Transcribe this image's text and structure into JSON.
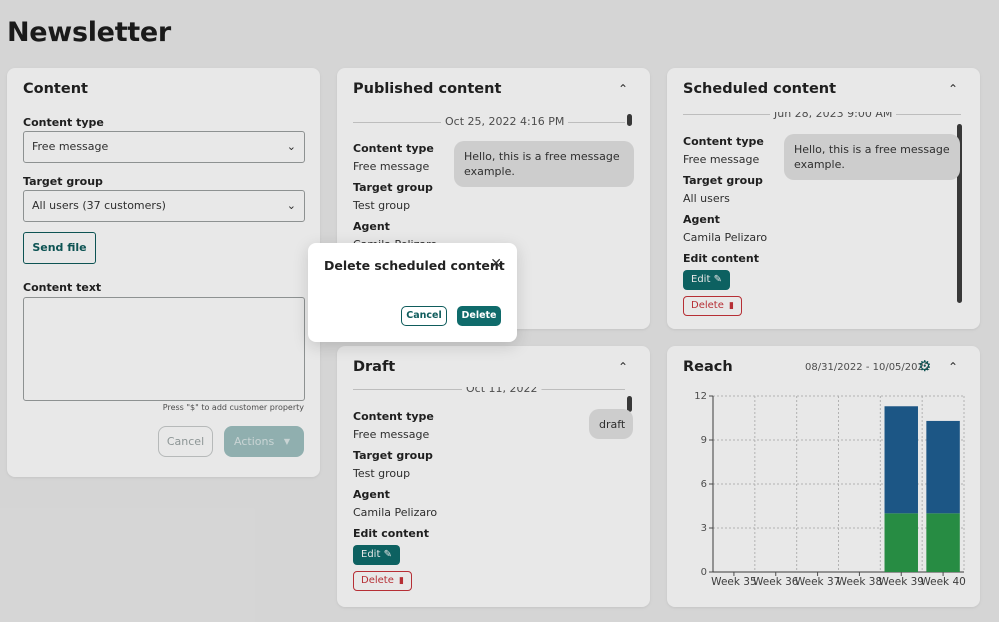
{
  "page": {
    "title": "Newsletter"
  },
  "content_card": {
    "title": "Content",
    "content_type_label": "Content type",
    "content_type_value": "Free message",
    "target_group_label": "Target group",
    "target_group_value": "All users (37 customers)",
    "send_file_label": "Send file",
    "content_text_label": "Content text",
    "hint": "Press \"$\" to add customer property",
    "cancel_label": "Cancel",
    "actions_label": "Actions"
  },
  "published_card": {
    "title": "Published content",
    "date": "Oct 25, 2022 4:16 PM",
    "content_type_label": "Content type",
    "content_type_value": "Free message",
    "target_group_label": "Target group",
    "target_group_value": "Test group",
    "agent_label": "Agent",
    "agent_value": "Camila Pelizaro",
    "bubble": "Hello, this is a free message example."
  },
  "scheduled_card": {
    "title": "Scheduled content",
    "date": "Jun 28, 2023 9:00 AM",
    "content_type_label": "Content type",
    "content_type_value": "Free message",
    "target_group_label": "Target group",
    "target_group_value": "All users",
    "agent_label": "Agent",
    "agent_value": "Camila Pelizaro",
    "edit_content_label": "Edit content",
    "edit_label": "Edit",
    "delete_label": "Delete",
    "bubble": "Hello, this is a free message example."
  },
  "draft_card": {
    "title": "Draft",
    "date": "Oct 11, 2022",
    "content_type_label": "Content type",
    "content_type_value": "Free message",
    "target_group_label": "Target group",
    "target_group_value": "Test group",
    "agent_label": "Agent",
    "agent_value": "Camila Pelizaro",
    "edit_content_label": "Edit content",
    "edit_label": "Edit",
    "delete_label": "Delete",
    "bubble": "draft"
  },
  "reach_card": {
    "title": "Reach",
    "date_range": "08/31/2022 - 10/05/2022"
  },
  "modal": {
    "title": "Delete scheduled content",
    "cancel_label": "Cancel",
    "delete_label": "Delete"
  },
  "icons": {
    "collapse": "chevron-up-icon",
    "select": "chevron-down-icon",
    "close": "close-icon",
    "settings": "gear-icon",
    "edit": "pencil-icon",
    "delete": "trash-icon"
  },
  "colors": {
    "accent": "#0f6b6b",
    "danger": "#c8343b",
    "series_blue": "#1f5f93",
    "series_green": "#2b9a4a"
  },
  "chart_data": {
    "type": "bar",
    "stacked": true,
    "categories": [
      "Week 35",
      "Week 36",
      "Week 37",
      "Week 38",
      "Week 39",
      "Week 40"
    ],
    "series": [
      {
        "values": [
          0,
          0,
          0,
          0,
          4,
          4
        ],
        "color": "#2b9a4a"
      },
      {
        "values": [
          0,
          0,
          0,
          0,
          7.3,
          6.3
        ],
        "color": "#1f5f93"
      }
    ],
    "y_ticks": [
      0,
      3,
      6,
      9,
      12
    ],
    "ylim": [
      0,
      12
    ],
    "grid": true
  }
}
